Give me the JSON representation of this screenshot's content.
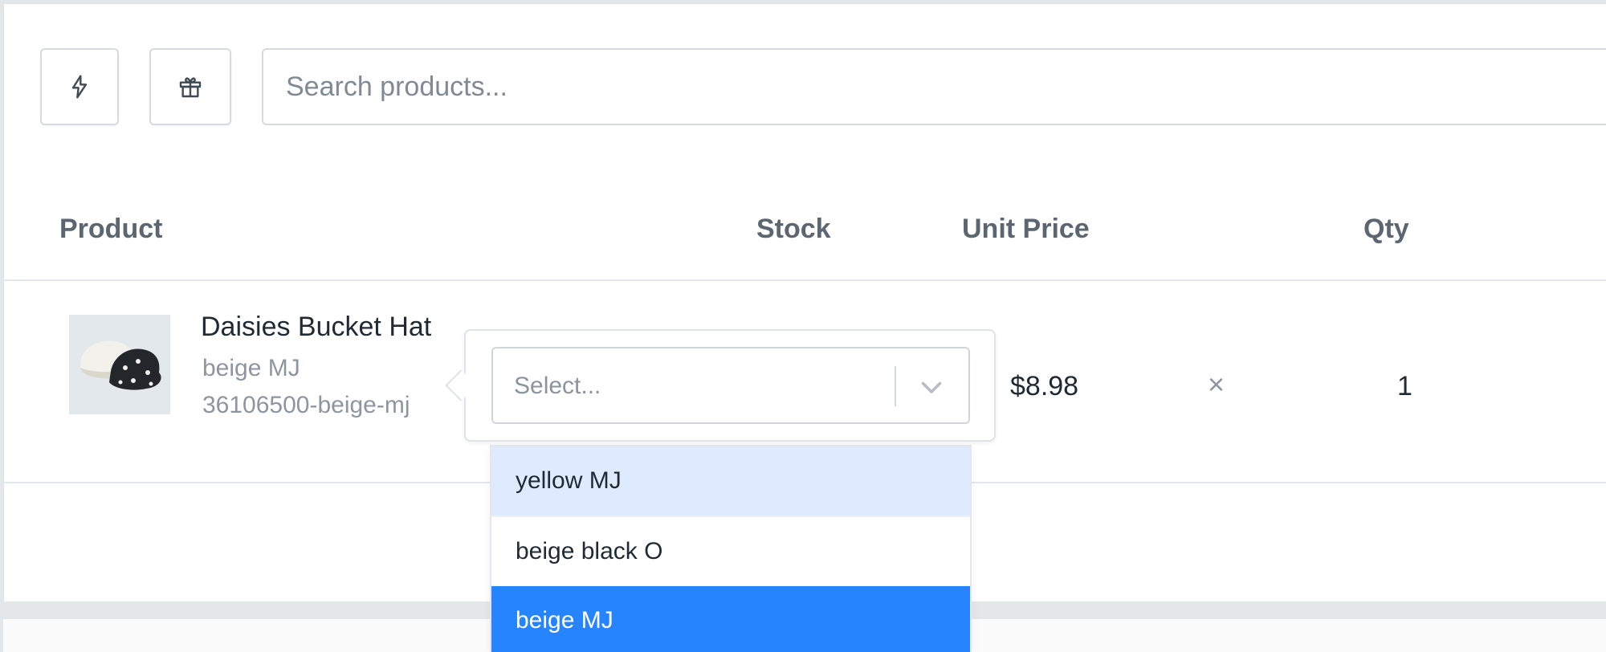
{
  "toolbar": {
    "quick_action_icon": "lightning-icon",
    "gift_icon": "gift-icon",
    "search_placeholder": "Search products..."
  },
  "table": {
    "headers": {
      "product": "Product",
      "stock": "Stock",
      "unit_price": "Unit Price",
      "qty": "Qty"
    },
    "row": {
      "name": "Daisies Bucket Hat",
      "variant": "beige MJ",
      "sku": "36106500-beige-mj",
      "unit_price": "$8.98",
      "multiply_symbol": "×",
      "qty": "1"
    }
  },
  "variant_select": {
    "placeholder": "Select...",
    "options": [
      "yellow MJ",
      "beige black O",
      "beige MJ"
    ],
    "focused_option": "yellow MJ",
    "selected_option": "beige MJ"
  },
  "colors": {
    "focus_bg": "#deebff",
    "selected_bg": "#2684ff"
  }
}
